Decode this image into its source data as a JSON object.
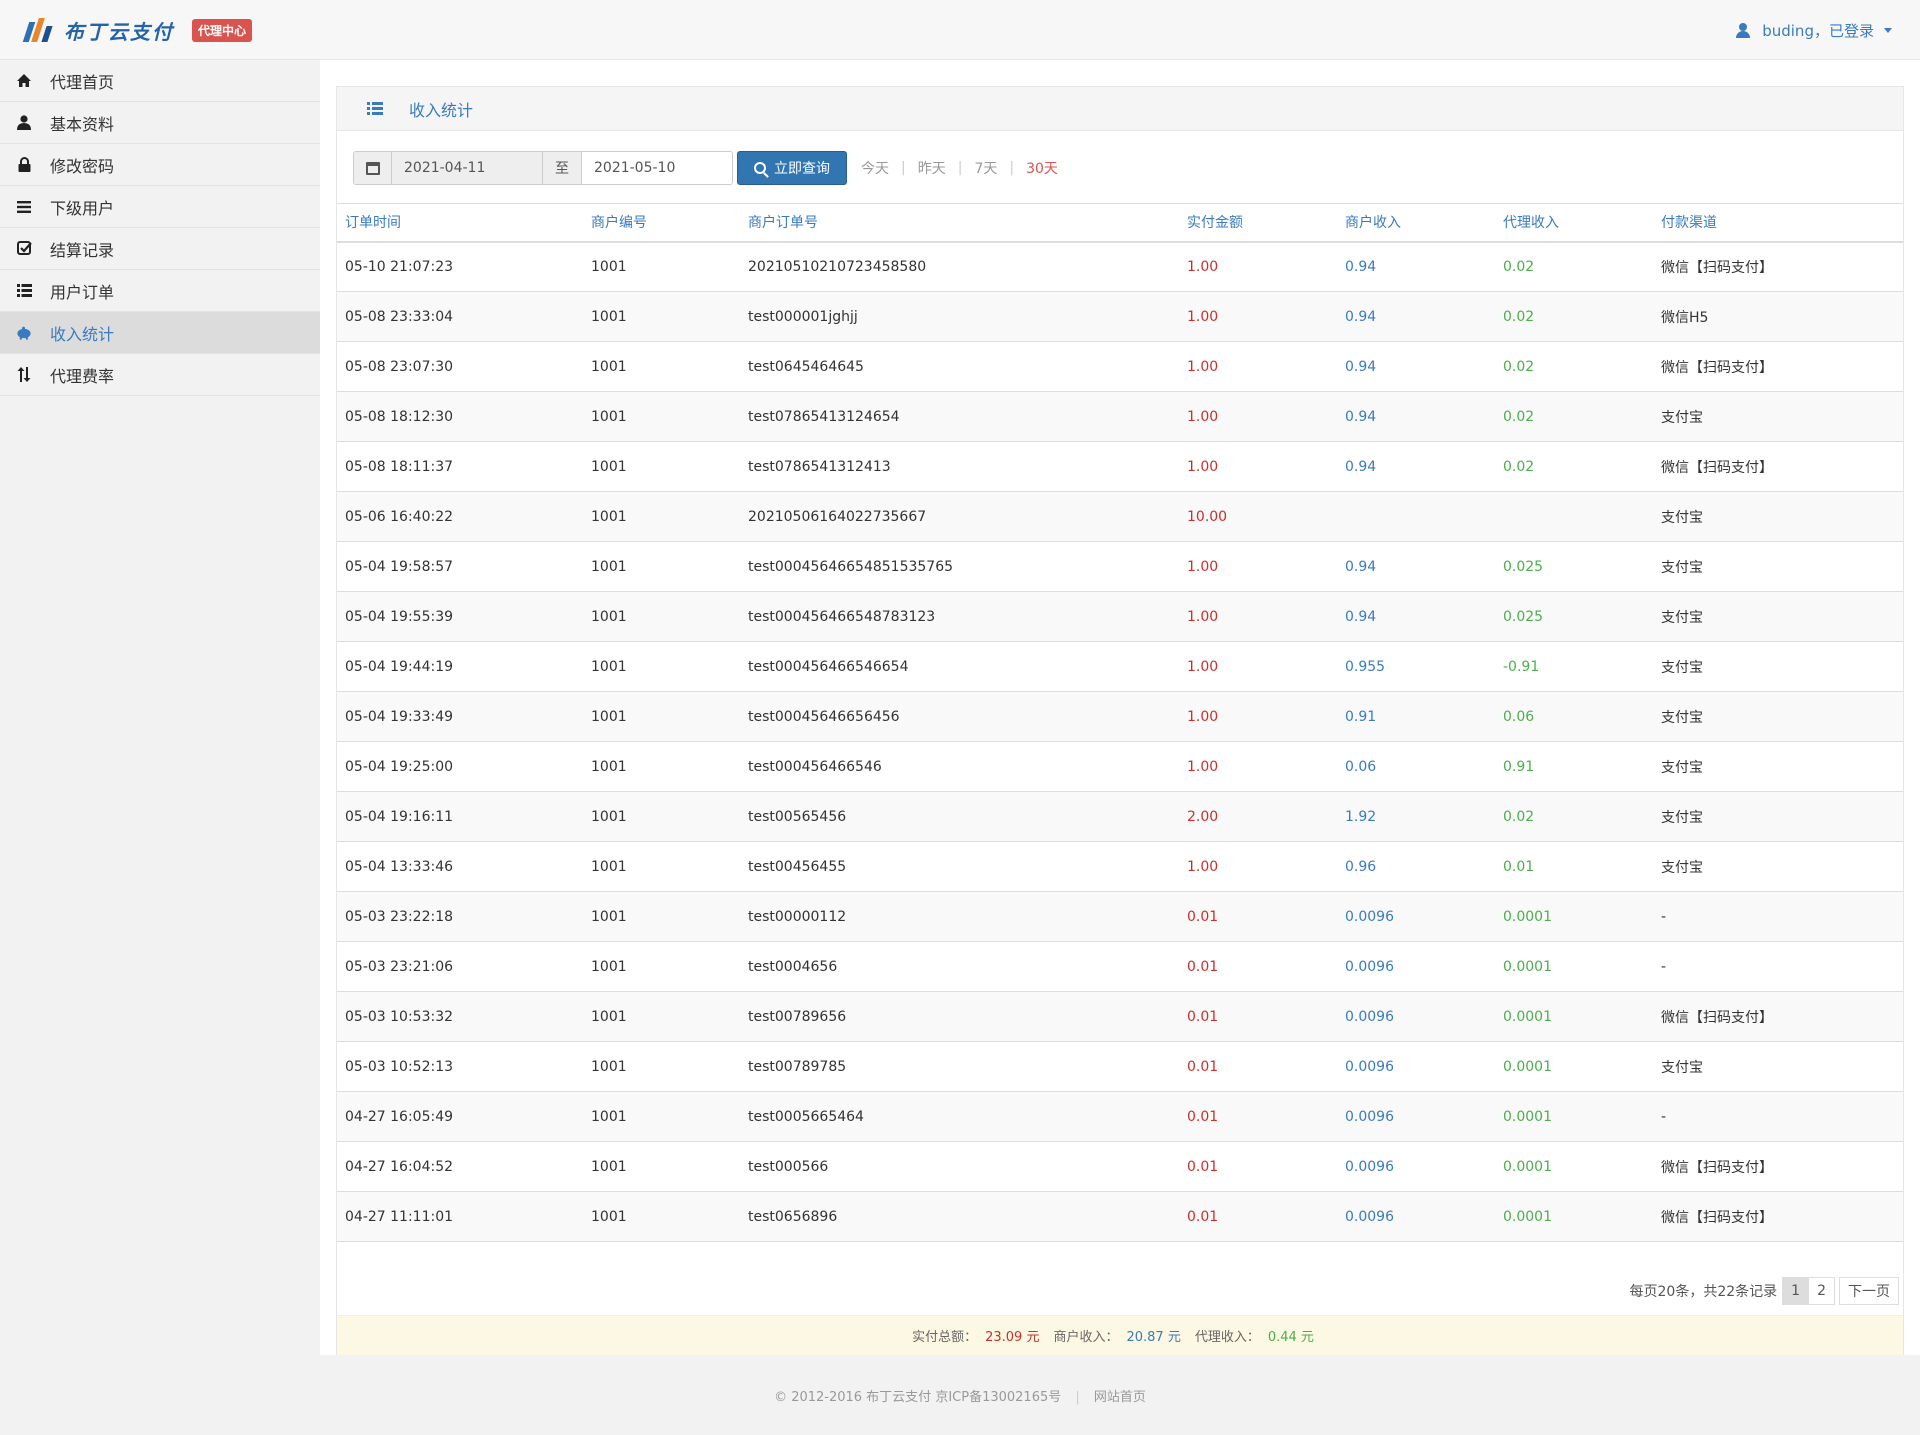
{
  "header": {
    "brand_name": "布丁云支付",
    "brand_tag": "代理中心",
    "user_name": "buding",
    "user_status": "已登录"
  },
  "sidebar": {
    "items": [
      {
        "label": "代理首页",
        "icon": "home-icon"
      },
      {
        "label": "基本资料",
        "icon": "user-icon"
      },
      {
        "label": "修改密码",
        "icon": "lock-icon"
      },
      {
        "label": "下级用户",
        "icon": "list-icon"
      },
      {
        "label": "结算记录",
        "icon": "check-icon"
      },
      {
        "label": "用户订单",
        "icon": "th-list-icon"
      },
      {
        "label": "收入统计",
        "icon": "piggy-bank-icon",
        "active": true
      },
      {
        "label": "代理费率",
        "icon": "sort-icon"
      }
    ]
  },
  "panel": {
    "title": "收入统计"
  },
  "filter": {
    "start_date": "2021-04-11",
    "to_label": "至",
    "end_date": "2021-05-10",
    "search_label": "立即查询",
    "quick": [
      "今天",
      "昨天",
      "7天",
      "30天"
    ],
    "quick_active": "30天"
  },
  "table": {
    "headers": [
      "订单时间",
      "商户编号",
      "商户订单号",
      "实付金额",
      "商户收入",
      "代理收入",
      "付款渠道"
    ],
    "rows": [
      [
        "05-10 21:07:23",
        "1001",
        "20210510210723458580",
        "1.00",
        "0.94",
        "0.02",
        "微信【扫码支付】"
      ],
      [
        "05-08 23:33:04",
        "1001",
        "test000001jghjj",
        "1.00",
        "0.94",
        "0.02",
        "微信H5"
      ],
      [
        "05-08 23:07:30",
        "1001",
        "test0645464645",
        "1.00",
        "0.94",
        "0.02",
        "微信【扫码支付】"
      ],
      [
        "05-08 18:12:30",
        "1001",
        "test07865413124654",
        "1.00",
        "0.94",
        "0.02",
        "支付宝"
      ],
      [
        "05-08 18:11:37",
        "1001",
        "test0786541312413",
        "1.00",
        "0.94",
        "0.02",
        "微信【扫码支付】"
      ],
      [
        "05-06 16:40:22",
        "1001",
        "20210506164022735667",
        "10.00",
        "",
        "",
        "支付宝"
      ],
      [
        "05-04 19:58:57",
        "1001",
        "test00045646654851535765",
        "1.00",
        "0.94",
        "0.025",
        "支付宝"
      ],
      [
        "05-04 19:55:39",
        "1001",
        "test000456466548783123",
        "1.00",
        "0.94",
        "0.025",
        "支付宝"
      ],
      [
        "05-04 19:44:19",
        "1001",
        "test000456466546654",
        "1.00",
        "0.955",
        "-0.91",
        "支付宝"
      ],
      [
        "05-04 19:33:49",
        "1001",
        "test00045646656456",
        "1.00",
        "0.91",
        "0.06",
        "支付宝"
      ],
      [
        "05-04 19:25:00",
        "1001",
        "test000456466546",
        "1.00",
        "0.06",
        "0.91",
        "支付宝"
      ],
      [
        "05-04 19:16:11",
        "1001",
        "test00565456",
        "2.00",
        "1.92",
        "0.02",
        "支付宝"
      ],
      [
        "05-04 13:33:46",
        "1001",
        "test00456455",
        "1.00",
        "0.96",
        "0.01",
        "支付宝"
      ],
      [
        "05-03 23:22:18",
        "1001",
        "test00000112",
        "0.01",
        "0.0096",
        "0.0001",
        "-"
      ],
      [
        "05-03 23:21:06",
        "1001",
        "test0004656",
        "0.01",
        "0.0096",
        "0.0001",
        "-"
      ],
      [
        "05-03 10:53:32",
        "1001",
        "test00789656",
        "0.01",
        "0.0096",
        "0.0001",
        "微信【扫码支付】"
      ],
      [
        "05-03 10:52:13",
        "1001",
        "test00789785",
        "0.01",
        "0.0096",
        "0.0001",
        "支付宝"
      ],
      [
        "04-27 16:05:49",
        "1001",
        "test0005665464",
        "0.01",
        "0.0096",
        "0.0001",
        "-"
      ],
      [
        "04-27 16:04:52",
        "1001",
        "test000566",
        "0.01",
        "0.0096",
        "0.0001",
        "微信【扫码支付】"
      ],
      [
        "04-27 11:11:01",
        "1001",
        "test0656896",
        "0.01",
        "0.0096",
        "0.0001",
        "微信【扫码支付】"
      ]
    ]
  },
  "pagination": {
    "info": "每页20条，共22条记录",
    "pages": [
      "1",
      "2"
    ],
    "current": "1",
    "next_label": "下一页"
  },
  "summary": {
    "paid_label": "实付总额：",
    "paid_value": "23.09 元",
    "merchant_label": "商户收入：",
    "merchant_value": "20.87 元",
    "agent_label": "代理收入：",
    "agent_value": "0.44 元"
  },
  "footer": {
    "copyright": "© 2012-2016  布丁云支付  京ICP备13002165号",
    "home_link": "网站首页"
  },
  "colors": {
    "accent": "#3a7bbf",
    "amount_red": "#c9302c",
    "income_green": "#4cae4c",
    "tag_red": "#d9534f"
  }
}
